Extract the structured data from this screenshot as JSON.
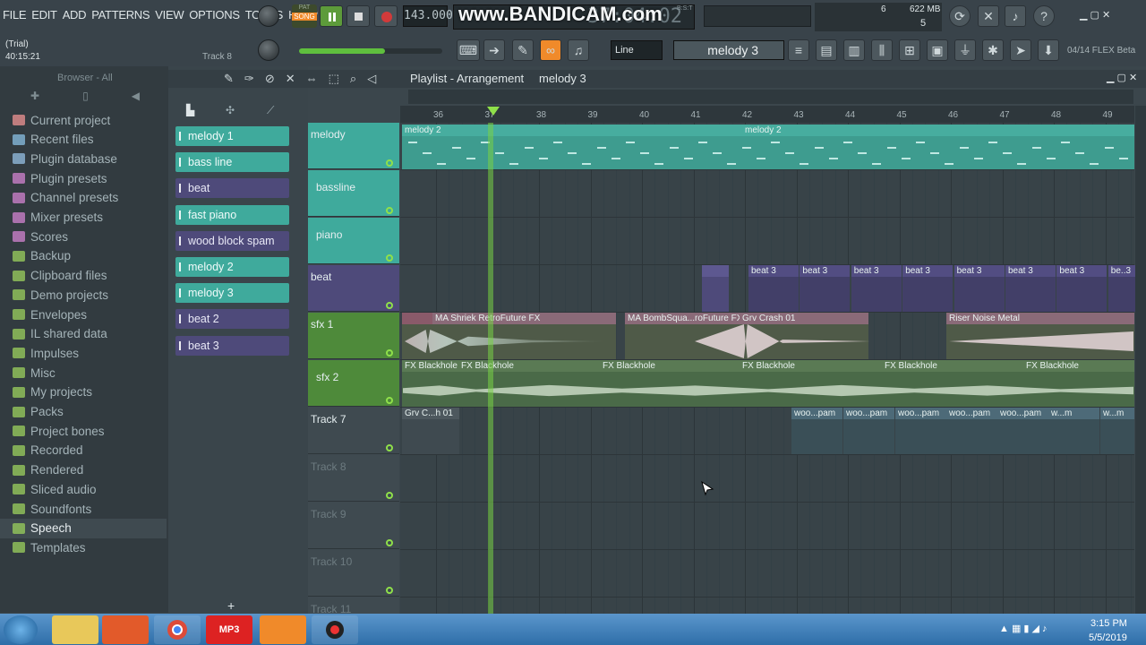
{
  "menu": [
    "FILE",
    "EDIT",
    "ADD",
    "PATTERNS",
    "VIEW",
    "OPTIONS",
    "TOOLS",
    "HELP"
  ],
  "mode": {
    "pat": "PAT",
    "song": "SONG"
  },
  "tempo": "143.000",
  "time": "37:04:02",
  "time_label": "B:S:T",
  "watermark": "www.BANDICAM.com",
  "cpu": "6",
  "memory": "622 MB",
  "voices": "5",
  "hint": {
    "trial": "(Trial)",
    "clock": "40:15:21",
    "track": "Track 8"
  },
  "snap": "Line",
  "pattern_selector": "melody 3",
  "flex": "04/14  FLEX Beta",
  "browser": {
    "title": "Browser - All",
    "items": [
      "Current project",
      "Recent files",
      "Plugin database",
      "Plugin presets",
      "Channel presets",
      "Mixer presets",
      "Scores",
      "Backup",
      "Clipboard files",
      "Demo projects",
      "Envelopes",
      "IL shared data",
      "Impulses",
      "Misc",
      "My projects",
      "Packs",
      "Project bones",
      "Recorded",
      "Rendered",
      "Sliced audio",
      "Soundfonts",
      "Speech",
      "Templates"
    ]
  },
  "patterns": [
    "melody 1",
    "bass line",
    "beat",
    "fast piano",
    "wood block spam",
    "melody 2",
    "melody 3",
    "beat 2",
    "beat 3"
  ],
  "playlist": {
    "title": "Playlist - Arrangement",
    "pattern": "melody 3"
  },
  "ruler": [
    "36",
    "37",
    "38",
    "39",
    "40",
    "41",
    "42",
    "43",
    "44",
    "45",
    "46",
    "47",
    "48",
    "49"
  ],
  "tracks": [
    "melody",
    "bassline",
    "piano",
    "beat",
    "sfx 1",
    "sfx 2",
    "Track 7",
    "Track 8",
    "Track 9",
    "Track 10",
    "Track 11"
  ],
  "clips": {
    "melody": [
      "melody 2",
      "melody 2"
    ],
    "beat": [
      "beat 3",
      "beat 3",
      "beat 3",
      "beat 3",
      "beat 3",
      "beat 3",
      "beat 3",
      "be..3"
    ],
    "sfx1": [
      "MA Shriek RetroFuture FX",
      "MA BombSqua...roFuture FX",
      "Grv Crash 01",
      "Riser Noise Metal"
    ],
    "sfx2": [
      "FX Blackhole",
      "FX Blackhole",
      "FX Blackhole",
      "FX Blackhole",
      "FX Blackhole",
      "FX Blackhole"
    ],
    "t7": [
      "Grv C...h 01",
      "woo...pam",
      "woo...pam",
      "woo...pam",
      "woo...pam",
      "woo...pam",
      "w...m"
    ]
  },
  "taskbar": {
    "time": "3:15 PM",
    "date": "5/5/2019",
    "mp3": "MP3"
  },
  "colors": {
    "teal": "#3faa9c",
    "purple": "#4e4a7a",
    "green": "#4e8a3a",
    "accent": "#f08a2a"
  }
}
